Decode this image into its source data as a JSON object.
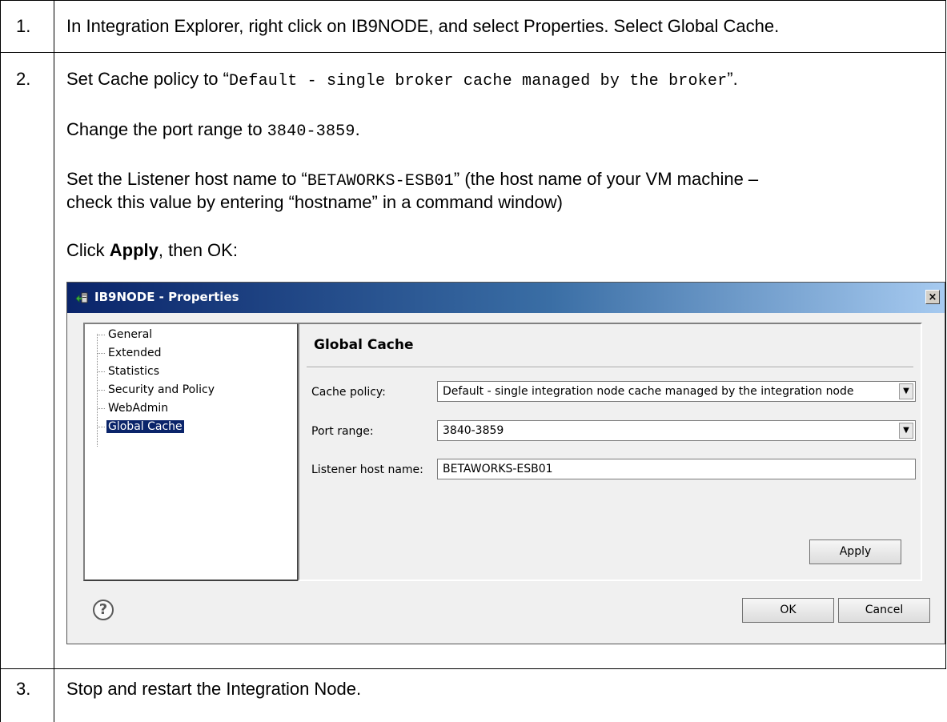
{
  "steps": [
    {
      "num": "1.",
      "text": "In Integration Explorer, right click on IB9NODE, and select Properties. Select Global Cache."
    },
    {
      "num": "2.",
      "line1_prefix": "Set Cache policy to “",
      "line1_code": "Default - single broker cache managed by the broker",
      "line1_suffix": "”.",
      "line2_prefix": "Change the port range to ",
      "line2_code": "3840-3859",
      "line2_suffix": ".",
      "line3_prefix": "Set the Listener host name to “",
      "line3_code": "BETAWORKS-ESB01",
      "line3_suffix": "” (the  host name of your VM machine –",
      "line4": "check this value by entering “hostname” in a command window)",
      "line5_prefix": "Click ",
      "line5_bold": "Apply",
      "line5_suffix": ", then OK:"
    },
    {
      "num": "3.",
      "text": "Stop and restart the Integration Node."
    }
  ],
  "dialog": {
    "title": "IB9NODE - Properties",
    "close_glyph": "×",
    "tree": [
      "General",
      "Extended",
      "Statistics",
      "Security and Policy",
      "WebAdmin",
      "Global Cache"
    ],
    "selected_index": 5,
    "panel_title": "Global Cache",
    "cache_policy_label": "Cache policy:",
    "cache_policy_value": "Default - single integration node cache managed by the integration node",
    "port_range_label": "Port range:",
    "port_range_value": "3840-3859",
    "listener_label": "Listener host name:",
    "listener_value": "BETAWORKS-ESB01",
    "apply_label": "Apply",
    "ok_label": "OK",
    "cancel_label": "Cancel",
    "help_glyph": "?",
    "dropdown_glyph": "▼"
  },
  "colors": {
    "titlebar_start": "#0a246a",
    "titlebar_end": "#a6caf0",
    "selection": "#0a246a"
  }
}
